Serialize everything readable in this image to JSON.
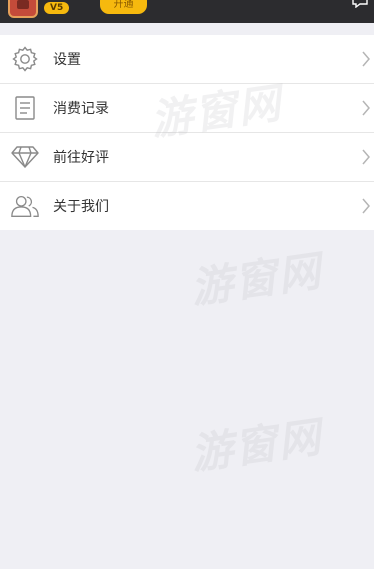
{
  "header": {
    "vip_label": "V5",
    "open_label": "开通"
  },
  "menu": {
    "items": [
      {
        "label": "设置",
        "icon": "gear-icon"
      },
      {
        "label": "消费记录",
        "icon": "document-list-icon"
      },
      {
        "label": "前往好评",
        "icon": "diamond-icon"
      },
      {
        "label": "关于我们",
        "icon": "users-icon"
      }
    ]
  },
  "watermark": {
    "text": "游窗网"
  }
}
